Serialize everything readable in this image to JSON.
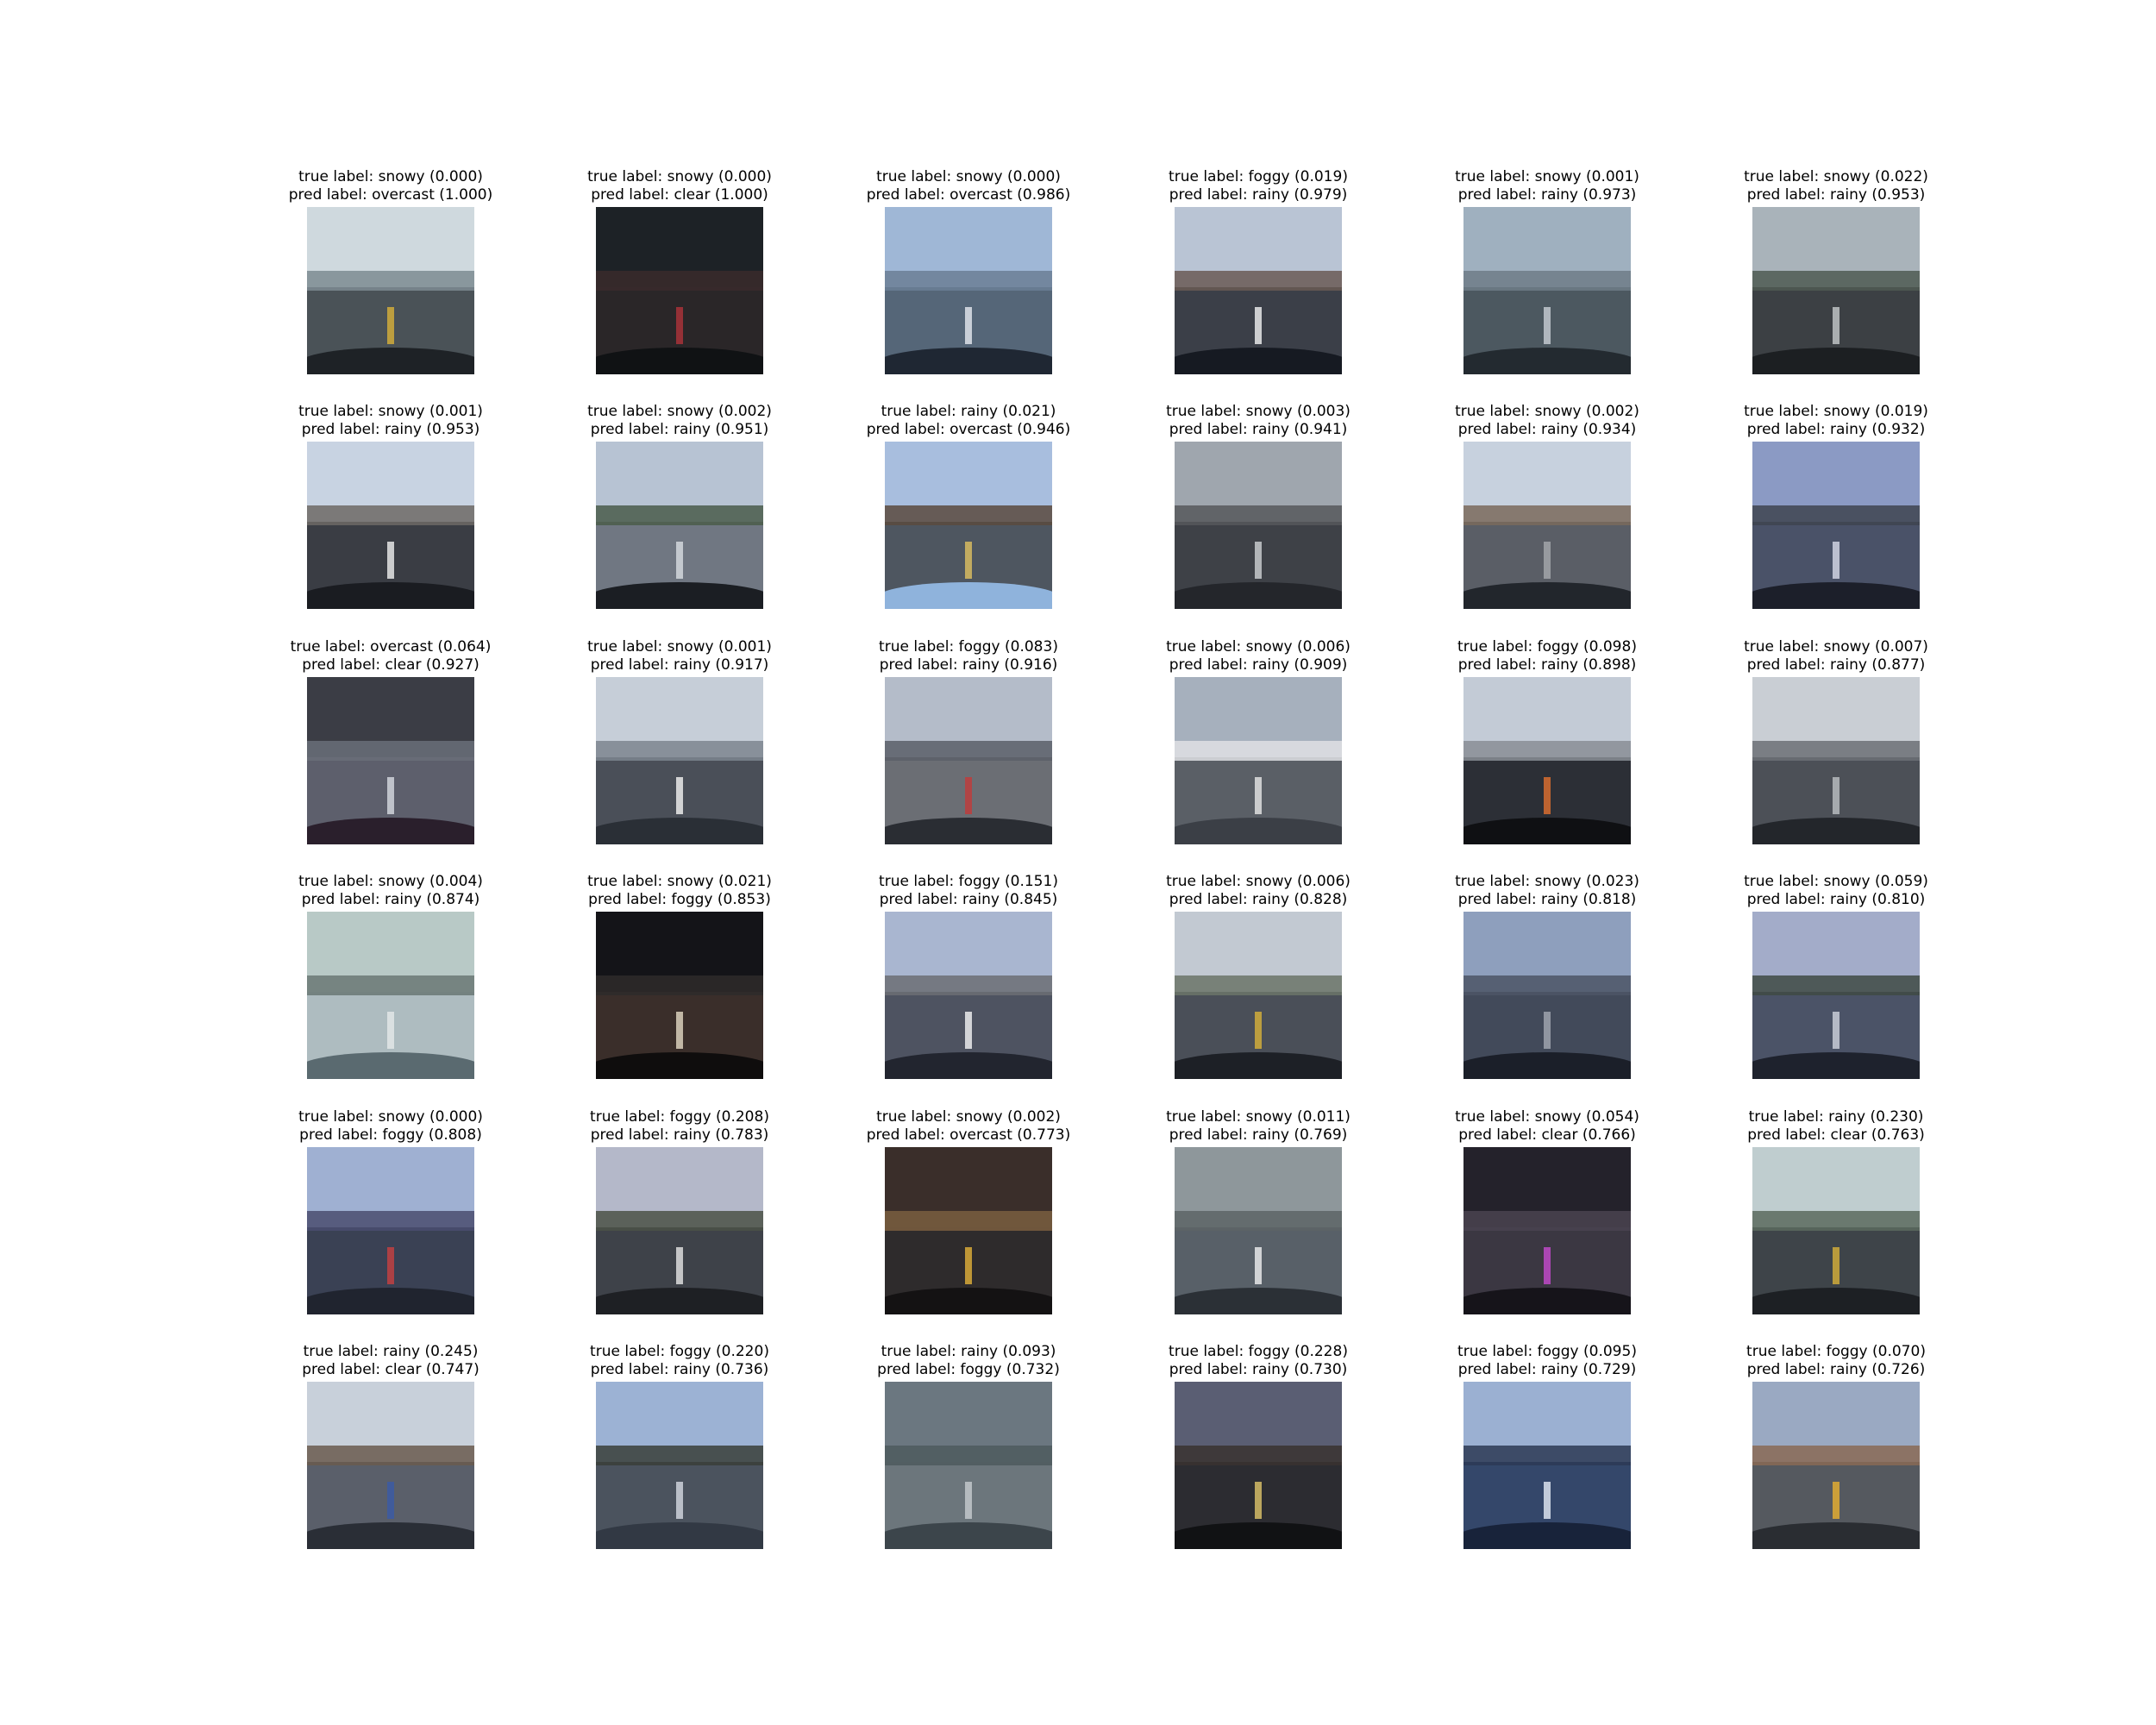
{
  "panels": [
    {
      "true_label": "true label: snowy (0.000)",
      "pred_label": "pred label: overcast (1.000)",
      "colors": {
        "sky": "#cfd9de",
        "mid": "#7d8b92",
        "road": "#4a5257",
        "dash": "#1e2226",
        "lane": "#d8b23a"
      }
    },
    {
      "true_label": "true label: snowy (0.000)",
      "pred_label": "pred label: clear (1.000)",
      "colors": {
        "sky": "#1d2226",
        "mid": "#3a2a2c",
        "road": "#2a2628",
        "dash": "#101214",
        "lane": "#b0333a"
      }
    },
    {
      "true_label": "true label: snowy (0.000)",
      "pred_label": "pred label: overcast (0.986)",
      "colors": {
        "sky": "#9fb7d6",
        "mid": "#6b7f95",
        "road": "#556678",
        "dash": "#1f2733",
        "lane": "#e6eaf0"
      }
    },
    {
      "true_label": "true label: foggy (0.019)",
      "pred_label": "pred label: rainy (0.979)",
      "colors": {
        "sky": "#b9c4d4",
        "mid": "#6a5a55",
        "road": "#3b3f48",
        "dash": "#161a22",
        "lane": "#f2f2f2"
      }
    },
    {
      "true_label": "true label: snowy (0.001)",
      "pred_label": "pred label: rainy (0.973)",
      "colors": {
        "sky": "#9fb0bf",
        "mid": "#6e7c87",
        "road": "#4c5860",
        "dash": "#232a30",
        "lane": "#c9d0d6"
      }
    },
    {
      "true_label": "true label: snowy (0.022)",
      "pred_label": "pred label: rainy (0.953)",
      "colors": {
        "sky": "#a9b3ba",
        "mid": "#4f5a52",
        "road": "#3c4044",
        "dash": "#1c1f22",
        "lane": "#c6c9cc"
      }
    },
    {
      "true_label": "true label: snowy (0.001)",
      "pred_label": "pred label: rainy (0.953)",
      "colors": {
        "sky": "#c8d3e2",
        "mid": "#6d6865",
        "road": "#3a3d44",
        "dash": "#1a1c21",
        "lane": "#f0f0f0"
      }
    },
    {
      "true_label": "true label: snowy (0.002)",
      "pred_label": "pred label: rainy (0.951)",
      "colors": {
        "sky": "#b7c3d3",
        "mid": "#4a5c4a",
        "road": "#707782",
        "dash": "#1b1e23",
        "lane": "#d9dde2"
      }
    },
    {
      "true_label": "true label: rainy (0.021)",
      "pred_label": "pred label: overcast (0.946)",
      "colors": {
        "sky": "#a8bede",
        "mid": "#5b4a3e",
        "road": "#4e5660",
        "dash": "#8fb3dc",
        "lane": "#e0c060"
      }
    },
    {
      "true_label": "true label: snowy (0.003)",
      "pred_label": "pred label: rainy (0.941)",
      "colors": {
        "sky": "#9fa6ae",
        "mid": "#56585c",
        "road": "#3e4147",
        "dash": "#24262b",
        "lane": "#d0d2d5"
      }
    },
    {
      "true_label": "true label: snowy (0.002)",
      "pred_label": "pred label: rainy (0.934)",
      "colors": {
        "sky": "#c7d1de",
        "mid": "#7a6a5c",
        "road": "#5a5e66",
        "dash": "#22262c",
        "lane": "#a6a9ae"
      }
    },
    {
      "true_label": "true label: snowy (0.019)",
      "pred_label": "pred label: rainy (0.932)",
      "colors": {
        "sky": "#8b9ac4",
        "mid": "#3e4450",
        "road": "#4a5268",
        "dash": "#1c1f2a",
        "lane": "#d7dbe8"
      }
    },
    {
      "true_label": "true label: overcast (0.064)",
      "pred_label": "pred label: clear (0.927)",
      "colors": {
        "sky": "#3b3d45",
        "mid": "#6a6e79",
        "road": "#5d5f6c",
        "dash": "#2a1f2c",
        "lane": "#d8dbe2"
      }
    },
    {
      "true_label": "true label: snowy (0.001)",
      "pred_label": "pred label: rainy (0.917)",
      "colors": {
        "sky": "#c6ced8",
        "mid": "#7d858f",
        "road": "#4a4f58",
        "dash": "#2a2f36",
        "lane": "#f4f4f4"
      }
    },
    {
      "true_label": "true label: foggy (0.083)",
      "pred_label": "pred label: rainy (0.916)",
      "colors": {
        "sky": "#b4bcc9",
        "mid": "#5a5f68",
        "road": "#6b6e74",
        "dash": "#2a2d33",
        "lane": "#c33a3a"
      }
    },
    {
      "true_label": "true label: snowy (0.006)",
      "pred_label": "pred label: rainy (0.909)",
      "colors": {
        "sky": "#a6b0bd",
        "mid": "#dfe1e4",
        "road": "#5a5f66",
        "dash": "#3b3f46",
        "lane": "#e7e7e7"
      }
    },
    {
      "true_label": "true label: foggy (0.098)",
      "pred_label": "pred label: rainy (0.898)",
      "colors": {
        "sky": "#c3cbd6",
        "mid": "#8a8e95",
        "road": "#2c2f36",
        "dash": "#0f1013",
        "lane": "#e2712f"
      }
    },
    {
      "true_label": "true label: snowy (0.007)",
      "pred_label": "pred label: rainy (0.877)",
      "colors": {
        "sky": "#c9ced4",
        "mid": "#6c7076",
        "road": "#4c5057",
        "dash": "#23262b",
        "lane": "#bdc0c4"
      }
    },
    {
      "true_label": "true label: snowy (0.004)",
      "pred_label": "pred label: rainy (0.874)",
      "colors": {
        "sky": "#b8c9c6",
        "mid": "#6a7874",
        "road": "#aebcc0",
        "dash": "#5a6a70",
        "lane": "#e5e8e9"
      }
    },
    {
      "true_label": "true label: snowy (0.021)",
      "pred_label": "pred label: foggy (0.853)",
      "colors": {
        "sky": "#141418",
        "mid": "#2e2a2a",
        "road": "#3a2e2a",
        "dash": "#0f0d0d",
        "lane": "#e3d9c4"
      }
    },
    {
      "true_label": "true label: foggy (0.151)",
      "pred_label": "pred label: rainy (0.845)",
      "colors": {
        "sky": "#a9b6d0",
        "mid": "#6c6e74",
        "road": "#4e5361",
        "dash": "#22252f",
        "lane": "#f5f5f5"
      }
    },
    {
      "true_label": "true label: snowy (0.006)",
      "pred_label": "pred label: rainy (0.828)",
      "colors": {
        "sky": "#c2c9d2",
        "mid": "#6b7468",
        "road": "#4a4f58",
        "dash": "#1d2026",
        "lane": "#d8b23a"
      }
    },
    {
      "true_label": "true label: snowy (0.023)",
      "pred_label": "pred label: rainy (0.818)",
      "colors": {
        "sky": "#8e9fbd",
        "mid": "#4c5566",
        "road": "#424a5a",
        "dash": "#1b1f29",
        "lane": "#a4a9b3"
      }
    },
    {
      "true_label": "true label: snowy (0.059)",
      "pred_label": "pred label: rainy (0.810)",
      "colors": {
        "sky": "#a3acc9",
        "mid": "#3f4a44",
        "road": "#4b5367",
        "dash": "#1e222d",
        "lane": "#d0d4de"
      }
    },
    {
      "true_label": "true label: snowy (0.000)",
      "pred_label": "pred label: foggy (0.808)",
      "colors": {
        "sky": "#9fb0d2",
        "mid": "#4a4d70",
        "road": "#3a4154",
        "dash": "#20242f",
        "lane": "#c94040"
      }
    },
    {
      "true_label": "true label: foggy (0.208)",
      "pred_label": "pred label: rainy (0.783)",
      "colors": {
        "sky": "#b4b8c9",
        "mid": "#4b5146",
        "road": "#3e4249",
        "dash": "#1e2024",
        "lane": "#e6e6e6"
      }
    },
    {
      "true_label": "true label: snowy (0.002)",
      "pred_label": "pred label: overcast (0.773)",
      "colors": {
        "sky": "#3a2e2a",
        "mid": "#7a5e40",
        "road": "#2e2b2c",
        "dash": "#141213",
        "lane": "#e2b23a"
      }
    },
    {
      "true_label": "true label: snowy (0.011)",
      "pred_label": "pred label: rainy (0.769)",
      "colors": {
        "sky": "#8e979b",
        "mid": "#5d6466",
        "road": "#586068",
        "dash": "#2b3036",
        "lane": "#f0f0f0"
      }
    },
    {
      "true_label": "true label: snowy (0.054)",
      "pred_label": "pred label: clear (0.766)",
      "colors": {
        "sky": "#24222b",
        "mid": "#4a4350",
        "road": "#3b3742",
        "dash": "#16141a",
        "lane": "#c74ad0"
      }
    },
    {
      "true_label": "true label: rainy (0.230)",
      "pred_label": "pred label: clear (0.763)",
      "colors": {
        "sky": "#bfcdcf",
        "mid": "#5a6a5e",
        "road": "#3e4449",
        "dash": "#1d2024",
        "lane": "#d8b23a"
      }
    },
    {
      "true_label": "true label: rainy (0.245)",
      "pred_label": "pred label: clear (0.747)",
      "colors": {
        "sky": "#c8d0da",
        "mid": "#6a5a4e",
        "road": "#5a5f6a",
        "dash": "#2a2e36",
        "lane": "#3a5aa8"
      }
    },
    {
      "true_label": "true label: foggy (0.220)",
      "pred_label": "pred label: rainy (0.736)",
      "colors": {
        "sky": "#9cb2d4",
        "mid": "#3a3e38",
        "road": "#4b535e",
        "dash": "#323944",
        "lane": "#d6dbe2"
      }
    },
    {
      "true_label": "true label: rainy (0.093)",
      "pred_label": "pred label: foggy (0.732)",
      "colors": {
        "sky": "#6b7780",
        "mid": "#4e5a5e",
        "road": "#6c767c",
        "dash": "#3c454b",
        "lane": "#c8cdd0"
      }
    },
    {
      "true_label": "true label: foggy (0.228)",
      "pred_label": "pred label: rainy (0.730)",
      "colors": {
        "sky": "#5a5e73",
        "mid": "#3a3330",
        "road": "#2c2c31",
        "dash": "#111214",
        "lane": "#e0c66a"
      }
    },
    {
      "true_label": "true label: foggy (0.095)",
      "pred_label": "pred label: rainy (0.729)",
      "colors": {
        "sky": "#9bb0d2",
        "mid": "#2d3a55",
        "road": "#34476a",
        "dash": "#18233a",
        "lane": "#e6ecf6"
      }
    },
    {
      "true_label": "true label: foggy (0.070)",
      "pred_label": "pred label: rainy (0.726)",
      "colors": {
        "sky": "#9aa9c2",
        "mid": "#8a6a55",
        "road": "#55595f",
        "dash": "#2a2d32",
        "lane": "#e8b030"
      }
    }
  ]
}
